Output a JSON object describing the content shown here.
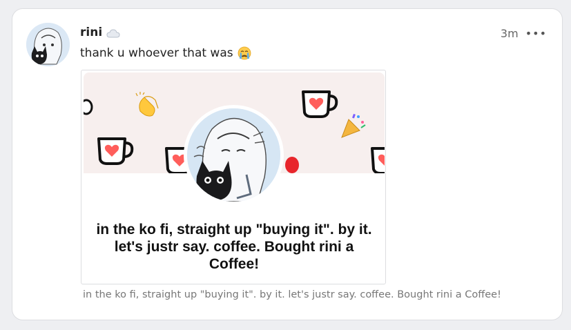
{
  "post": {
    "username": "rini",
    "timestamp": "3m",
    "text": "thank u whoever that was",
    "status_icon": "cloud-icon",
    "text_emoji": "crying-emoji-icon"
  },
  "embed": {
    "title": "in the ko fi, straight up \"buying it\". by it. let's justr say. coffee. Bought rini a Coffee!",
    "caption": "in the ko fi, straight up \"buying it\". by it. let's justr say. coffee. Bought rini a Coffee!",
    "banner_icons": [
      "coffee-cup-icon",
      "clapping-hands-icon",
      "party-popper-icon",
      "balloon-icon"
    ]
  },
  "colors": {
    "accent_red": "#ff5e5b",
    "banner_bg": "#f7efee",
    "card_border": "#dcdde0"
  }
}
